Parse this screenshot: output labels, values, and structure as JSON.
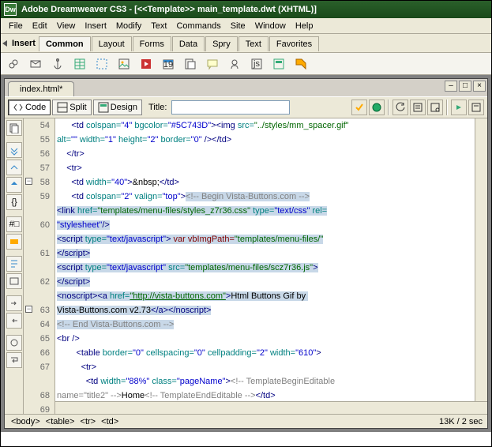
{
  "app": {
    "name": "Adobe Dreamweaver CS3",
    "doc": "[<<Template>> main_template.dwt (XHTML)]"
  },
  "menu": [
    "File",
    "Edit",
    "View",
    "Insert",
    "Modify",
    "Text",
    "Commands",
    "Site",
    "Window",
    "Help"
  ],
  "insertbar": {
    "label": "Insert",
    "tabs": [
      "Common",
      "Layout",
      "Forms",
      "Data",
      "Spry",
      "Text",
      "Favorites"
    ],
    "active": 0
  },
  "doc": {
    "tab": "index.html*"
  },
  "viewbar": {
    "code": "Code",
    "split": "Split",
    "design": "Design",
    "title_label": "Title:",
    "title_value": ""
  },
  "gutter": [
    54,
    55,
    56,
    57,
    58,
    59,
    "",
    60,
    "",
    61,
    "",
    62,
    "",
    63,
    64,
    65,
    66,
    67,
    "",
    68,
    69
  ],
  "code_lines": [
    {
      "n": 54,
      "html": "      <span class='tag'>&lt;td</span> <span class='attr'>colspan=</span><span class='val'>\"4\"</span> <span class='attr'>bgcolor=</span><span class='val'>\"#5C743D\"</span><span class='tag'>&gt;&lt;img</span> <span class='attr'>src=</span><span class='str'>\"../styles/mm_spacer.gif\"</span>"
    },
    {
      "html": "<span class='attr'>alt=</span><span class='val'>\"\"</span> <span class='attr'>width=</span><span class='val'>\"1\"</span> <span class='attr'>height=</span><span class='val'>\"2\"</span> <span class='attr'>border=</span><span class='val'>\"0\"</span> <span class='tag'>/&gt;&lt;/td&gt;</span>"
    },
    {
      "n": 55,
      "html": "    <span class='tag'>&lt;/tr&gt;</span>"
    },
    {
      "n": 56,
      "html": "    <span class='tag'>&lt;tr&gt;</span>"
    },
    {
      "n": 57,
      "html": "      <span class='tag'>&lt;td</span> <span class='attr'>width=</span><span class='val'>\"40\"</span><span class='tag'>&gt;</span><span class='plain'>&amp;nbsp;</span><span class='tag'>&lt;/td&gt;</span>"
    },
    {
      "n": 58,
      "html": "      <span class='tag'>&lt;td</span> <span class='attr'>colspan=</span><span class='val'>\"2\"</span> <span class='attr'>valign=</span><span class='val'>\"top\"</span><span class='tag'>&gt;</span><span class='sel'><span class='cmt'>&lt;!-- Begin Vista-Buttons.com --&gt;</span></span>"
    },
    {
      "n": 59,
      "html": "<span class='sel'><span class='tag'>&lt;link</span> <span class='attr'>href=</span><span class='str'>\"templates/menu-files/styles_z7r36.css\"</span> <span class='attr'>type=</span><span class='val'>\"text/css\"</span> <span class='attr'>rel=</span></span>"
    },
    {
      "html": "<span class='sel'><span class='val'>\"stylesheet\"</span><span class='tag'>/&gt;</span></span>"
    },
    {
      "n": 60,
      "html": "<span class='sel'><span class='tag'>&lt;script</span> <span class='attr'>type=</span><span class='val'>\"text/javascript\"</span><span class='tag'>&gt;</span><span class='kw'> var vbImgPath=</span><span class='str'>\"templates/menu-files/\"</span></span>"
    },
    {
      "html": "<span class='sel'><span class='tag'>&lt;/script&gt;</span></span>"
    },
    {
      "n": 61,
      "html": "<span class='sel'><span class='tag'>&lt;script</span> <span class='attr'>type=</span><span class='val'>\"text/javascript\"</span> <span class='attr'>src=</span><span class='str'>\"templates/menu-files/scz7r36.js\"</span><span class='tag'>&gt;</span></span>"
    },
    {
      "html": "<span class='sel'><span class='tag'>&lt;/script&gt;</span></span>"
    },
    {
      "n": 62,
      "html": "<span class='sel'><span class='tag'>&lt;noscript&gt;&lt;a</span> <span class='attr'>href=</span><span class='link'>\"http://vista-buttons.com\"</span><span class='tag'>&gt;</span><span class='plain'>Html Buttons Gif by </span></span>"
    },
    {
      "html": "<span class='sel'><span class='plain'>Vista-Buttons.com v2.73</span><span class='tag'>&lt;/a&gt;&lt;/noscript&gt;</span></span>"
    },
    {
      "n": 63,
      "html": "<span class='sel'><span class='cmt'>&lt;!-- End Vista-Buttons.com --&gt;</span></span>"
    },
    {
      "n": 64,
      "html": "<span class='tag'>&lt;br</span> <span class='tag'>/&gt;</span>"
    },
    {
      "n": 65,
      "html": "        <span class='tag'>&lt;table</span> <span class='attr'>border=</span><span class='val'>\"0\"</span> <span class='attr'>cellspacing=</span><span class='val'>\"0\"</span> <span class='attr'>cellpadding=</span><span class='val'>\"2\"</span> <span class='attr'>width=</span><span class='val'>\"610\"</span><span class='tag'>&gt;</span>"
    },
    {
      "n": 66,
      "html": "          <span class='tag'>&lt;tr&gt;</span>"
    },
    {
      "n": 67,
      "html": "            <span class='tag'>&lt;td</span> <span class='attr'>width=</span><span class='val'>\"88%\"</span> <span class='attr'>class=</span><span class='val'>\"pageName\"</span><span class='tag'>&gt;</span><span class='cmt'>&lt;!-- TemplateBeginEditable </span>"
    },
    {
      "html": "<span class='cmt'>name=\"title2\" --&gt;</span><span class='plain'>Home</span><span class='cmt'>&lt;!-- TemplateEndEditable --&gt;</span><span class='tag'>&lt;/td&gt;</span>"
    },
    {
      "n": 68,
      "html": "          <span class='tag'>&lt;/tr&gt;</span>"
    },
    {
      "n": 69,
      "html": "        <span class='tag'>&lt;/table&gt;</span>     <span class='tag'>&lt;/td&gt;</span>"
    }
  ],
  "status": {
    "path": [
      "<body>",
      "<table>",
      "<tr>",
      "<td>"
    ],
    "right": "13K / 2 sec"
  }
}
